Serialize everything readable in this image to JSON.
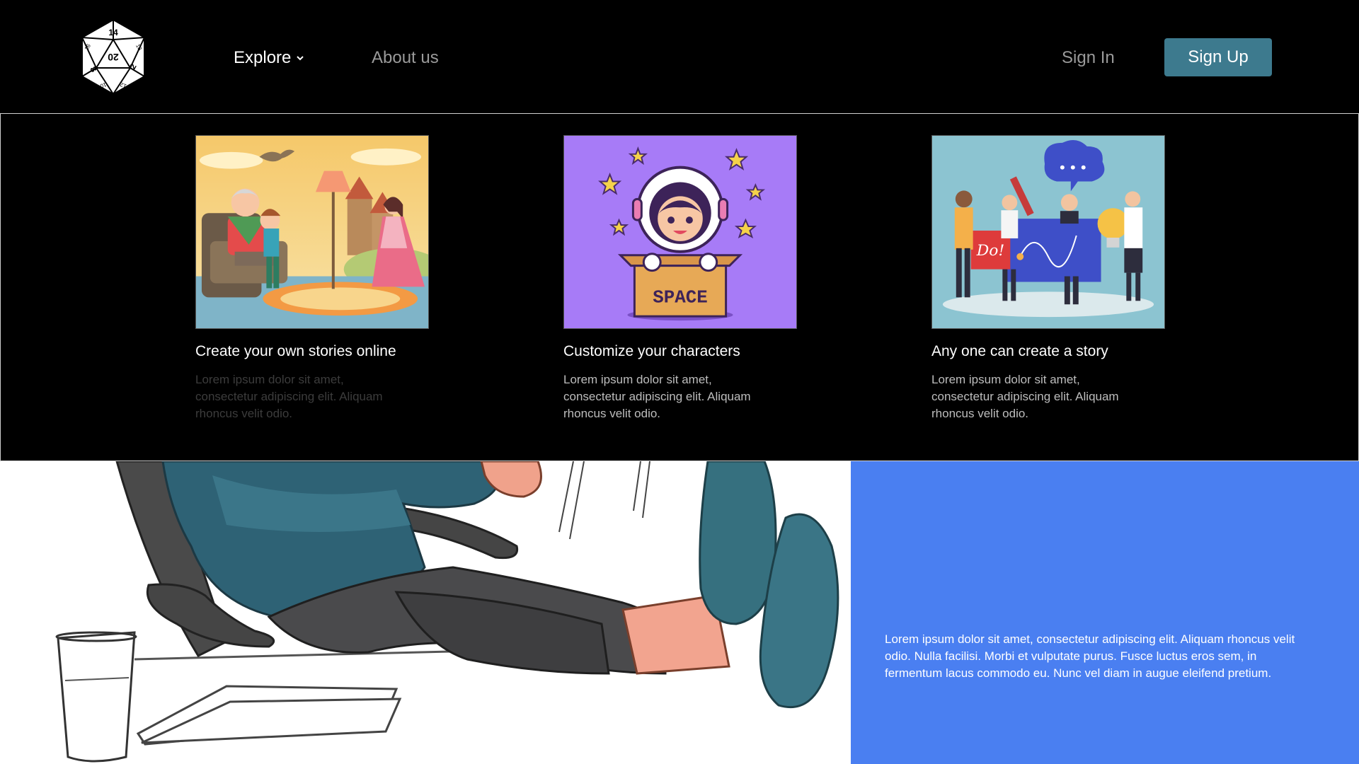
{
  "header": {
    "logo_icon": "d20-dice-icon",
    "logo_numbers": [
      "14",
      "18",
      "20",
      "2",
      "8",
      "10",
      "12",
      "16"
    ],
    "nav": {
      "explore_label": "Explore",
      "about_label": "About us"
    },
    "auth": {
      "signin_label": "Sign In",
      "signup_label": "Sign Up"
    }
  },
  "dropdown": {
    "cards": [
      {
        "image_icon": "storytelling-illustration",
        "title": "Create your own stories online",
        "description": "Lorem ipsum dolor sit amet, consectetur adipiscing elit. Aliquam rhoncus velit odio."
      },
      {
        "image_icon": "astronaut-in-box-illustration",
        "image_text": "SPACE",
        "title": "Customize your characters",
        "description": "Lorem ipsum dolor sit amet, consectetur adipiscing elit. Aliquam rhoncus velit odio."
      },
      {
        "image_icon": "team-brainstorm-illustration",
        "image_text": "Do!",
        "title": "Any one can create a story",
        "description": "Lorem ipsum dolor sit amet, consectetur adipiscing elit. Aliquam rhoncus velit odio."
      }
    ]
  },
  "hero": {
    "illustration_icon": "person-feet-on-desk-illustration",
    "text": "Lorem ipsum dolor sit amet, consectetur adipiscing elit. Aliquam rhoncus velit odio. Nulla facilisi. Morbi et vulputate purus. Fusce luctus eros sem, in fermentum lacus commodo eu. Nunc vel diam in augue eleifend pretium."
  },
  "colors": {
    "header_bg": "#000000",
    "signup_bg": "#3d7a8e",
    "hero_blue": "#4a7ff1",
    "nav_muted": "#9a9a9a"
  }
}
